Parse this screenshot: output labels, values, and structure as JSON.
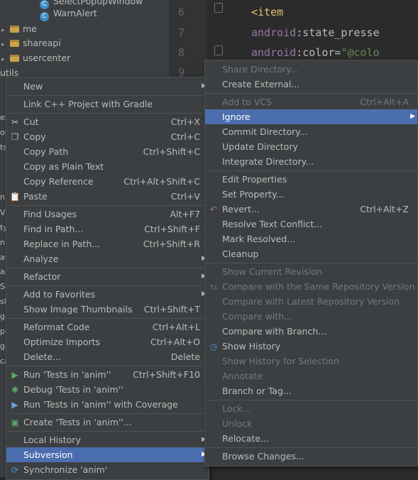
{
  "project_tree": {
    "items": [
      {
        "label": "SelectPopupWindow",
        "kind": "class"
      },
      {
        "label": "WarnAlert",
        "kind": "class"
      },
      {
        "label": "me",
        "kind": "folder"
      },
      {
        "label": "shareapi",
        "kind": "folder"
      },
      {
        "label": "usercenter",
        "kind": "folder"
      },
      {
        "label": "utils",
        "kind": "folder"
      }
    ]
  },
  "editor": {
    "lines": [
      {
        "num": "6",
        "parts": [
          {
            "t": "<item",
            "c": "tag"
          }
        ]
      },
      {
        "num": "7",
        "parts": [
          {
            "t": "android",
            "c": "attr-ns"
          },
          {
            "t": ":state_presse",
            "c": "attr"
          }
        ]
      },
      {
        "num": "8",
        "parts": [
          {
            "t": "android",
            "c": "attr-ns"
          },
          {
            "t": ":color=",
            "c": "attr"
          },
          {
            "t": "\"@colo",
            "c": "str"
          }
        ]
      },
      {
        "num": "9",
        "parts": []
      }
    ]
  },
  "main_menu": {
    "items": [
      {
        "label": "New",
        "arrow": true
      },
      {
        "sep": true
      },
      {
        "label": "Link C++ Project with Gradle"
      },
      {
        "sep": true
      },
      {
        "label": "Cut",
        "shortcut": "Ctrl+X",
        "icon": "scissors-icon"
      },
      {
        "label": "Copy",
        "shortcut": "Ctrl+C",
        "icon": "copy-icon"
      },
      {
        "label": "Copy Path",
        "shortcut": "Ctrl+Shift+C"
      },
      {
        "label": "Copy as Plain Text"
      },
      {
        "label": "Copy Reference",
        "shortcut": "Ctrl+Alt+Shift+C"
      },
      {
        "label": "Paste",
        "shortcut": "Ctrl+V",
        "icon": "paste-icon"
      },
      {
        "sep": true
      },
      {
        "label": "Find Usages",
        "shortcut": "Alt+F7"
      },
      {
        "label": "Find in Path...",
        "shortcut": "Ctrl+Shift+F"
      },
      {
        "label": "Replace in Path...",
        "shortcut": "Ctrl+Shift+R"
      },
      {
        "label": "Analyze",
        "arrow": true
      },
      {
        "sep": true
      },
      {
        "label": "Refactor",
        "arrow": true
      },
      {
        "sep": true
      },
      {
        "label": "Add to Favorites",
        "arrow": true
      },
      {
        "label": "Show Image Thumbnails",
        "shortcut": "Ctrl+Shift+T"
      },
      {
        "sep": true
      },
      {
        "label": "Reformat Code",
        "shortcut": "Ctrl+Alt+L"
      },
      {
        "label": "Optimize Imports",
        "shortcut": "Ctrl+Alt+O"
      },
      {
        "label": "Delete...",
        "shortcut": "Delete"
      },
      {
        "sep": true
      },
      {
        "label": "Run 'Tests in 'anim''",
        "shortcut": "Ctrl+Shift+F10",
        "icon": "run-icon"
      },
      {
        "label": "Debug 'Tests in 'anim''",
        "icon": "debug-icon"
      },
      {
        "label": "Run 'Tests in 'anim'' with Coverage",
        "icon": "coverage-icon"
      },
      {
        "sep": true
      },
      {
        "label": "Create 'Tests in 'anim''...",
        "icon": "create-test-icon"
      },
      {
        "sep": true
      },
      {
        "label": "Local History",
        "arrow": true
      },
      {
        "label": "Subversion",
        "arrow": true,
        "selected": true
      },
      {
        "label": "Synchronize 'anim'",
        "icon": "sync-icon"
      }
    ]
  },
  "sub_menu": {
    "items": [
      {
        "label": "Share Directory...",
        "disabled": true
      },
      {
        "label": "Create External..."
      },
      {
        "sep": true
      },
      {
        "label": "Add to VCS",
        "shortcut": "Ctrl+Alt+A",
        "disabled": true
      },
      {
        "label": "Ignore",
        "arrow": true,
        "selected": true,
        "disabled": true
      },
      {
        "label": "Commit Directory..."
      },
      {
        "label": "Update Directory"
      },
      {
        "label": "Integrate Directory..."
      },
      {
        "sep": true
      },
      {
        "label": "Edit Properties"
      },
      {
        "label": "Set Property..."
      },
      {
        "label": "Revert...",
        "shortcut": "Ctrl+Alt+Z",
        "icon": "revert-icon"
      },
      {
        "label": "Resolve Text Conflict..."
      },
      {
        "label": "Mark Resolved..."
      },
      {
        "label": "Cleanup"
      },
      {
        "sep": true
      },
      {
        "label": "Show Current Revision",
        "disabled": true
      },
      {
        "label": "Compare with the Same Repository Version",
        "disabled": true,
        "icon": "compare-icon"
      },
      {
        "label": "Compare with Latest Repository Version",
        "disabled": true
      },
      {
        "label": "Compare with...",
        "disabled": true
      },
      {
        "label": "Compare with Branch..."
      },
      {
        "label": "Show History",
        "icon": "history-icon"
      },
      {
        "label": "Show History for Selection",
        "disabled": true
      },
      {
        "label": "Annotate",
        "disabled": true
      },
      {
        "label": "Branch or Tag..."
      },
      {
        "sep": true
      },
      {
        "label": "Lock...",
        "disabled": true
      },
      {
        "label": "Unlock",
        "disabled": true
      },
      {
        "label": "Relocate..."
      },
      {
        "sep": true
      },
      {
        "label": "Browse Changes..."
      }
    ]
  },
  "edge_fragments": [
    "ex",
    "ou",
    "ts",
    "ni",
    "Vi",
    "ty",
    "nij",
    "av",
    "ap",
    "Sc",
    "sh",
    "ga",
    "pe",
    "ga",
    "ca"
  ],
  "colors": {
    "selection": "#4b6eaf",
    "menu_bg": "#3c3f41",
    "editor_bg": "#2b2b2b"
  }
}
